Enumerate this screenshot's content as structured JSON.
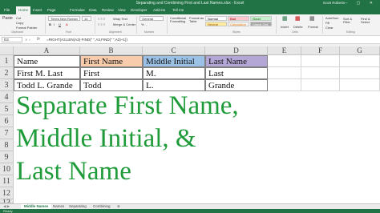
{
  "window": {
    "title": "Separating and Combining First and Last Names.xlsx - Excel",
    "user": "Scott Roberts",
    "controls": "–  ▢  ✕"
  },
  "tabs": [
    "File",
    "Home",
    "Insert",
    "Page Layout",
    "Formulas",
    "Data",
    "Review",
    "View",
    "Developer",
    "Add-ins",
    "Tell me"
  ],
  "ribbon": {
    "paste": "Paste",
    "cut": "Cut",
    "copy": "Copy",
    "format_painter": "Format Painter",
    "font_name": "Times New Roman",
    "font_size": "14",
    "bold": "B",
    "italic": "I",
    "underline": "U",
    "wrap_text": "Wrap Text",
    "merge_center": "Merge & Center",
    "number_format": "General",
    "percent": "%",
    "comma": ",",
    "conditional": "Conditional Formatting",
    "format_as_table": "Format as Table",
    "styles": [
      {
        "label": "Normal",
        "bg": "#ffffff",
        "fg": "#000000"
      },
      {
        "label": "Bad",
        "bg": "#ffc7ce",
        "fg": "#9c0006"
      },
      {
        "label": "Good",
        "bg": "#c6efce",
        "fg": "#006100"
      },
      {
        "label": "Neutral",
        "bg": "#ffeb9c",
        "fg": "#9c5700"
      },
      {
        "label": "Calculation",
        "bg": "#f2f2f2",
        "fg": "#fa7d00"
      },
      {
        "label": "Check Cell",
        "bg": "#a5a5a5",
        "fg": "#ffffff"
      }
    ],
    "insert": "Insert",
    "delete": "Delete",
    "format": "Format",
    "autosum": "AutoSum",
    "fill": "Fill",
    "clear": "Clear",
    "sort_filter": "Sort & Filter",
    "find_select": "Find & Select",
    "group_clipboard": "Clipboard",
    "group_font": "Font",
    "group_alignment": "Alignment",
    "group_number": "Number",
    "group_styles": "Styles",
    "group_cells": "Cells",
    "group_editing": "Editing"
  },
  "formula_bar": {
    "name_box": "D3",
    "fx": "fx",
    "formula": "=RIGHT(A3,LEN(A3)-FIND(\" \",A3,FIND(\" \",A3)+1))"
  },
  "columns": [
    "A",
    "B",
    "C",
    "D",
    "E",
    "F",
    "G"
  ],
  "rows": [
    "1",
    "2",
    "3",
    "4",
    "5",
    "6",
    "7",
    "8",
    "9",
    "10",
    "11",
    "12",
    "13"
  ],
  "cells": {
    "a1": "Name",
    "b1": "First Name",
    "c1": "Middle Initial",
    "d1": "Last Name",
    "a2": "First M. Last",
    "b2": "First",
    "c2": "M.",
    "d2": "Last",
    "a3": "Todd L. Grande",
    "b3": "Todd",
    "c3": "L.",
    "d3": "Grande"
  },
  "header_colors": {
    "first_name": "#f8cbad",
    "middle_initial": "#9bc2e6",
    "last_name": "#b4a7d6"
  },
  "banner": {
    "line1": "Separate First Name,",
    "line2": "Middle Initial, &",
    "line3": "Last Name",
    "color": "#1f9b3a"
  },
  "sheets": [
    "Middle Names",
    "Names",
    "Separating",
    "Combining"
  ],
  "active_sheet": "Middle Names",
  "status": "Ready"
}
